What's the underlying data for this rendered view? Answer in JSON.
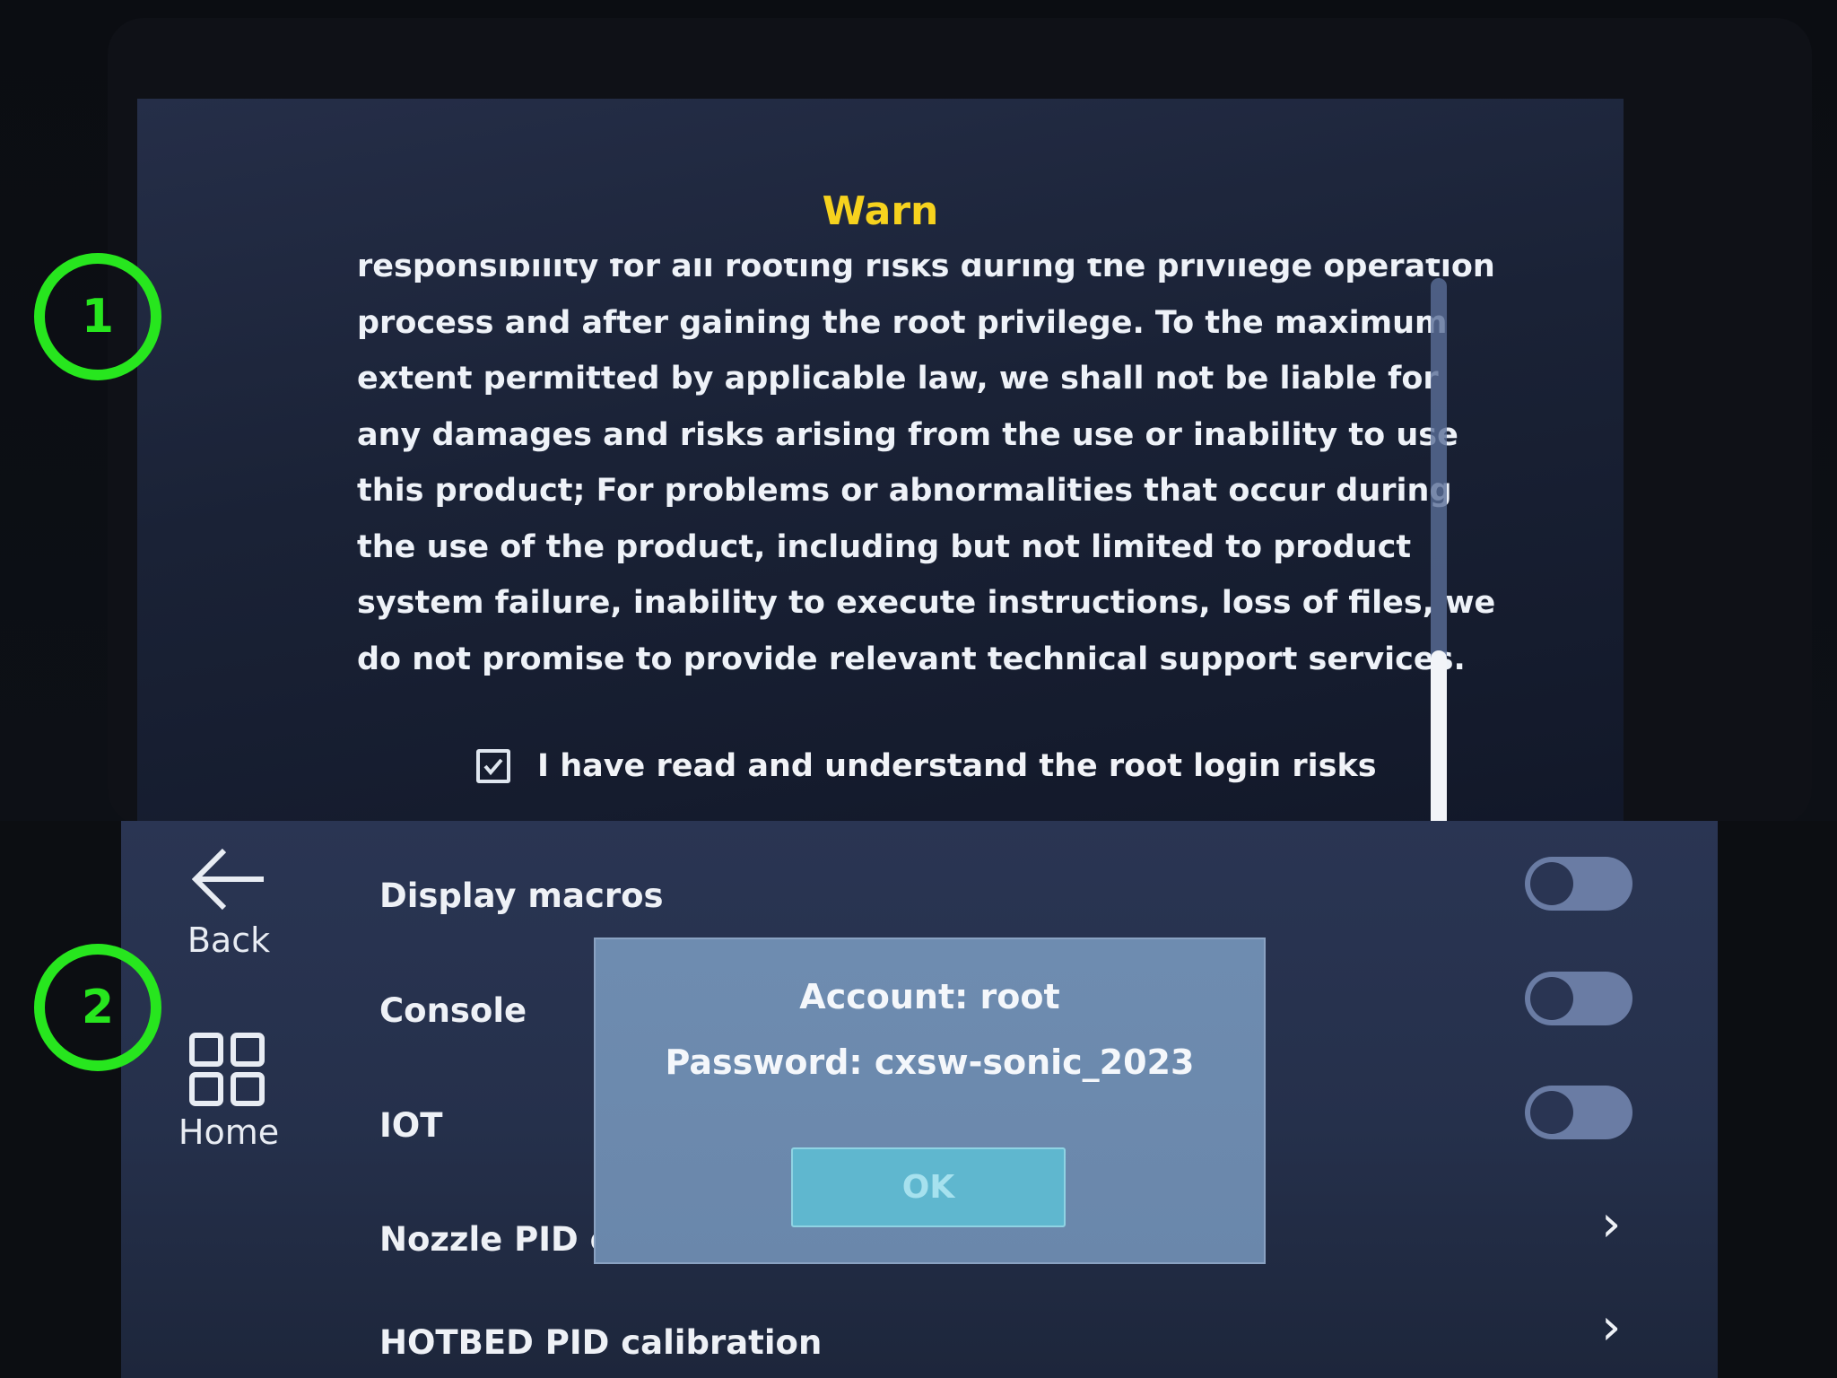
{
  "markers": [
    "1",
    "2"
  ],
  "warning_dialog": {
    "title": "Warn",
    "body_lines": [
      "responsibility for all rooting risks during the privilege operation",
      "process and after gaining the root privilege. To the maximum",
      "extent permitted by applicable law, we shall not be liable for",
      "any damages and risks arising from the use or inability to use",
      "this product; For problems or abnormalities that occur during",
      "the use of the product, including but not limited to product",
      "system failure, inability to execute instructions, loss of files, we",
      "do not promise to provide relevant technical support services."
    ],
    "checkbox_label": "I have read and understand the root login risks",
    "checkbox_checked": true,
    "title_color": "#f6d21e"
  },
  "settings": {
    "nav": {
      "back_label": "Back",
      "home_label": "Home",
      "back_icon": "arrow-left-icon",
      "home_icon": "grid-icon"
    },
    "items": [
      {
        "label": "Display macros",
        "control": "toggle"
      },
      {
        "label": "Console",
        "control": "toggle"
      },
      {
        "label": "IOT",
        "control": "toggle"
      },
      {
        "label": "Nozzle PID c",
        "control": "chevron"
      },
      {
        "label": "HOTBED PID calibration",
        "control": "chevron"
      }
    ]
  },
  "credentials_popup": {
    "account_line": "Account:  root",
    "password_line": "Password:  cxsw-sonic_2023",
    "ok_label": "OK"
  }
}
